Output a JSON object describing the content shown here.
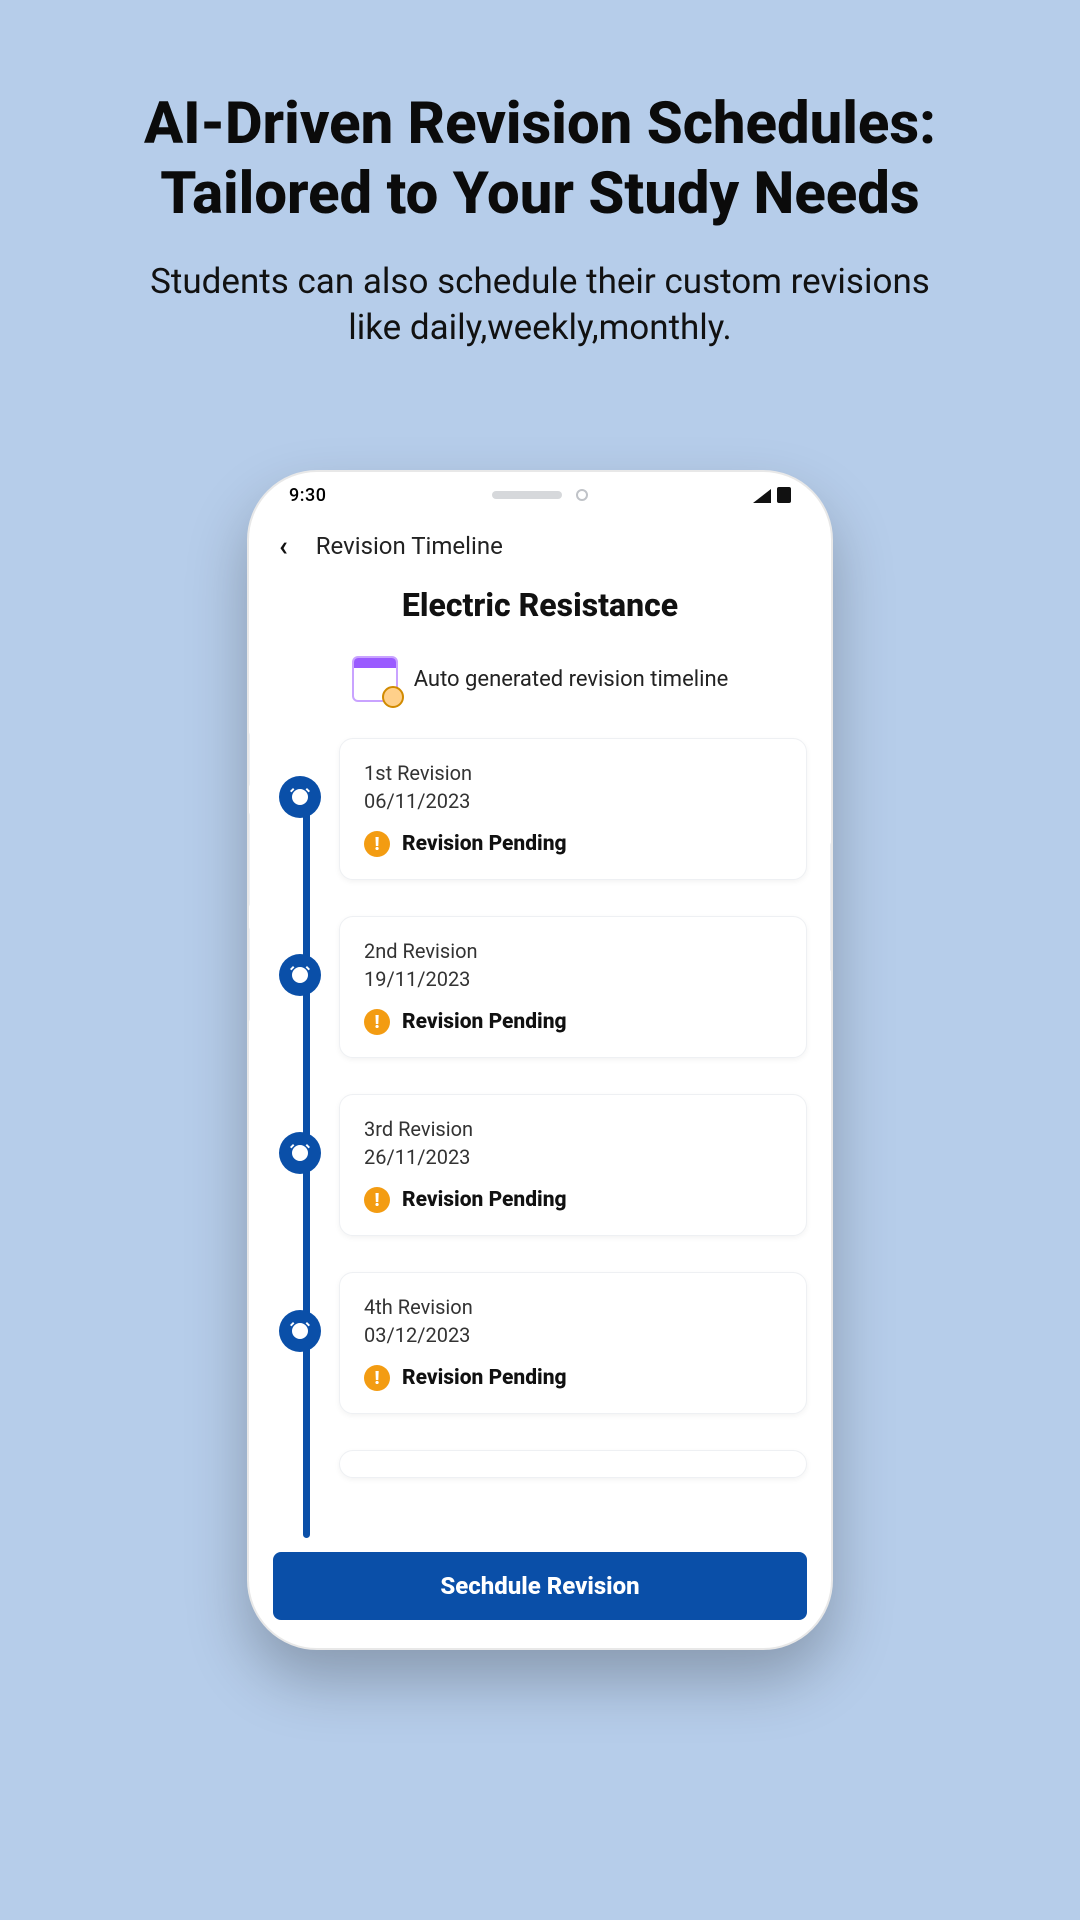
{
  "page": {
    "title_line1": "AI-Driven Revision Schedules:",
    "title_line2": "Tailored to Your Study Needs",
    "subtitle_line1": "Students can also schedule their custom revisions",
    "subtitle_line2": "like daily,weekly,monthly."
  },
  "phone": {
    "status_time": "9:30",
    "nav_title": "Revision Timeline",
    "topic_title": "Electric Resistance",
    "subline": "Auto generated revision timeline",
    "cta_label": "Sechdule Revision",
    "status_label": "Revision Pending",
    "revisions": [
      {
        "label": "1st Revision",
        "date": "06/11/2023"
      },
      {
        "label": "2nd Revision",
        "date": "19/11/2023"
      },
      {
        "label": "3rd Revision",
        "date": "26/11/2023"
      },
      {
        "label": "4th Revision",
        "date": "03/12/2023"
      }
    ]
  }
}
